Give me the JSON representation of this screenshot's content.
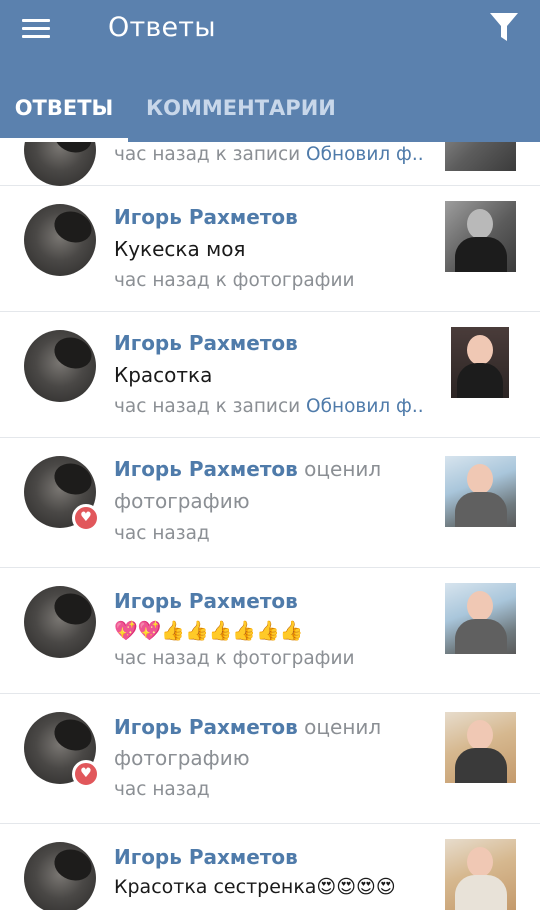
{
  "app": {
    "title": "Ответы"
  },
  "tabs": [
    {
      "label": "ОТВЕТЫ",
      "active": true
    },
    {
      "label": "КОММЕНТАРИИ",
      "active": false
    }
  ],
  "items": [
    {
      "meta": "час назад к записи ",
      "meta_link": "Обновил ф..",
      "thumb": "photo"
    },
    {
      "name": "Игорь Рахметов",
      "text": "Кукеска моя",
      "meta": "час назад к фотографии",
      "thumb": "photo"
    },
    {
      "name": "Игорь Рахметов",
      "text": "Красотка",
      "meta": "час назад к записи ",
      "meta_link": "Обновил ф..",
      "thumb": "photo"
    },
    {
      "name": "Игорь Рахметов",
      "verb": " оценил",
      "verb2": "фотографию",
      "meta": "час назад",
      "badge": "heart",
      "thumb": "photo"
    },
    {
      "name": "Игорь Рахметов",
      "text": "💖💖👍👍👍👍👍👍",
      "meta": "час назад к фотографии",
      "thumb": "photo"
    },
    {
      "name": "Игорь Рахметов",
      "verb": " оценил",
      "verb2": "фотографию",
      "meta": "час назад",
      "badge": "heart",
      "thumb": "photo"
    },
    {
      "name": "Игорь Рахметов",
      "text": "Красотка сестренка😍😍😍😍",
      "thumb": "photo"
    }
  ],
  "colors": {
    "appbar": "#5b81ae",
    "name": "#4f7baa",
    "meta": "#8b8f94",
    "heart": "#e1575b"
  },
  "icons": {
    "menu": "menu-icon",
    "filter": "filter-icon",
    "heart": "heart-icon"
  }
}
